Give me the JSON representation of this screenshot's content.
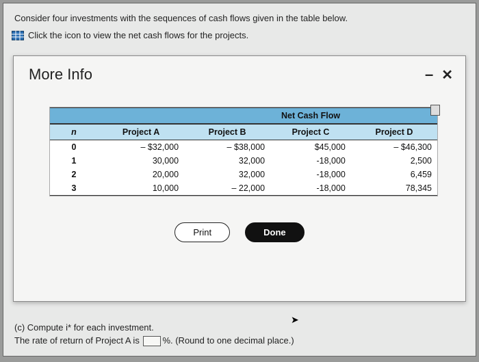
{
  "instructions": "Consider four investments with the sequences of cash flows given in the table below.",
  "linkText": "Click the icon to view the net cash flows for the projects.",
  "dialog": {
    "title": "More Info",
    "superHeader": "Net Cash Flow",
    "cols": {
      "n": "n",
      "a": "Project A",
      "b": "Project B",
      "c": "Project C",
      "d": "Project D"
    },
    "rows": [
      {
        "n": "0",
        "a": "– $32,000",
        "b": "– $38,000",
        "c": "$45,000",
        "d": "– $46,300"
      },
      {
        "n": "1",
        "a": "30,000",
        "b": "32,000",
        "c": "-18,000",
        "d": "2,500"
      },
      {
        "n": "2",
        "a": "20,000",
        "b": "32,000",
        "c": "-18,000",
        "d": "6,459"
      },
      {
        "n": "3",
        "a": "10,000",
        "b": "– 22,000",
        "c": "-18,000",
        "d": "78,345"
      }
    ],
    "printLabel": "Print",
    "doneLabel": "Done"
  },
  "partC": "(c) Compute i* for each investment.",
  "rateSentence1": "The rate of return of Project A is ",
  "rateSentence2": "%. (Round to one decimal place.)"
}
